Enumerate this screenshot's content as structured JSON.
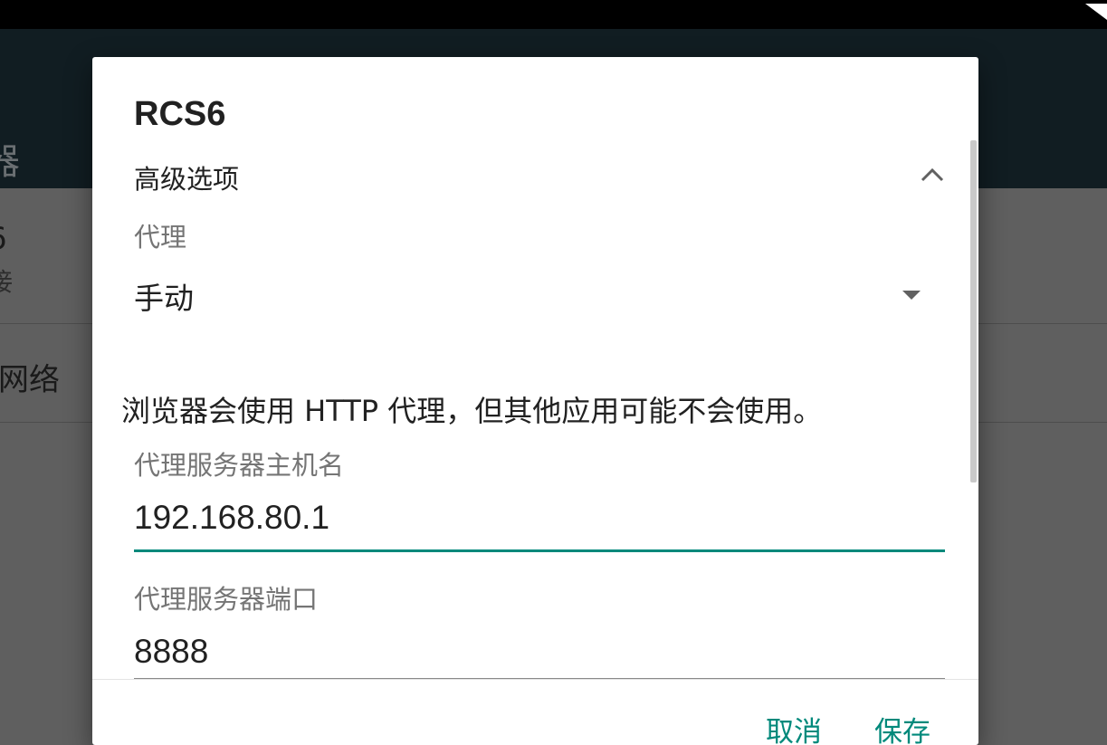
{
  "background": {
    "title_fragment": "器",
    "row1_title_fragment": "6",
    "row1_subtitle_fragment": "接",
    "row2_fragment": "网络"
  },
  "dialog": {
    "title": "RCS6",
    "advanced_options_label": "高级选项",
    "proxy_label": "代理",
    "proxy_value": "手动",
    "notice": "浏览器会使用 HTTP 代理，但其他应用可能不会使用。",
    "host_label": "代理服务器主机名",
    "host_value": "192.168.80.1",
    "port_label": "代理服务器端口",
    "port_value": "8888",
    "cancel_label": "取消",
    "save_label": "保存"
  },
  "colors": {
    "accent": "#00897b",
    "scrim": "#5f5f5f",
    "appbar": "#111d22"
  },
  "icons": {
    "status_wifi": "wifi-icon",
    "advanced_toggle": "chevron-up-icon",
    "proxy_dropdown": "caret-down-icon"
  }
}
